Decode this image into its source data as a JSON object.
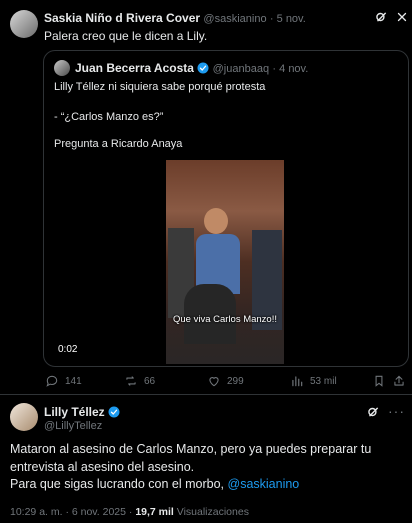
{
  "retweet_post": {
    "author_name": "Saskia Niño d Rivera Cover",
    "handle": "@saskianino",
    "date": "· 5 nov.",
    "text": "Palera creo que le dicen a Lily.",
    "quoted": {
      "author_name": "Juan Becerra Acosta",
      "handle": "@juanbaaq",
      "date": "· 4 nov.",
      "line1": "Lilly Téllez ni siquiera sabe porqué protesta",
      "line2": "- “¿Carlos Manzo es?”",
      "line3": "Pregunta a Ricardo Anaya",
      "video": {
        "caption": "Que viva Carlos Manzo!!",
        "time": "0:02"
      }
    },
    "actions": {
      "replies": "141",
      "reposts": "66",
      "likes": "299",
      "views": "53 mil"
    }
  },
  "main_post": {
    "author_name": "Lilly Téllez",
    "handle": "@LillyTellez",
    "text_line1": "Mataron al asesino de Carlos Manzo, pero ya puedes preparar tu",
    "text_line2": "entrevista al asesino del asesino.",
    "text_line3": "Para que sigas lucrando con el morbo,",
    "mention": "@saskianino",
    "timestamp": "10:29 a. m. · 6 nov. 2025 ·",
    "views_count": "19,7 mil",
    "views_label": "Visualizaciones"
  },
  "colors": {
    "background": "#000000",
    "text": "#e7e9ea",
    "muted": "#71767b",
    "accent": "#1d9bf0",
    "verified": "#1d9bf0"
  }
}
